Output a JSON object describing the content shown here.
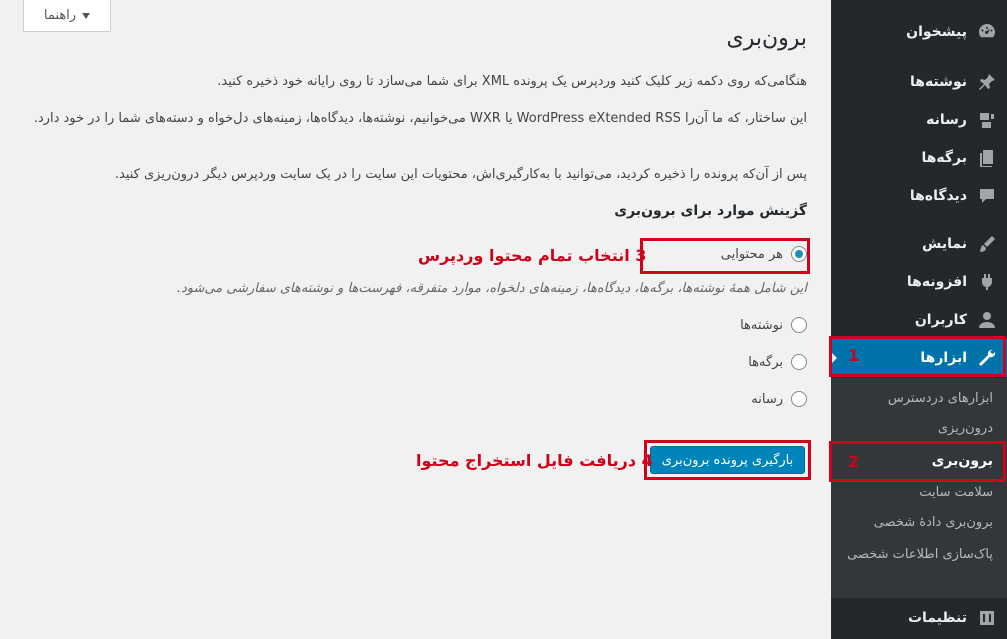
{
  "header": {
    "help_label": "راهنما",
    "page_title": "برون‌بری"
  },
  "intro": [
    "هنگامی‌که روی دکمه زیر کلیک کنید وردپرس یک پرونده XML برای شما می‌سازد تا روی رایانه خود ذخیره کنید.",
    "این ساختار، که ما آن‌را WordPress eXtended RSS یا WXR می‌خوانیم، نوشته‌ها، دیدگاه‌ها، زمینه‌های دل‌خواه و دسته‌های شما را در خود دارد.",
    "پس از آن‌که پرونده را ذخیره کردید، می‌توانید با به‌کارگیری‌اش، محتویات این سایت را در یک سایت وردپرس دیگر درون‌ریزی کنید."
  ],
  "export": {
    "section_title": "گزینش موارد برای برون‌بری",
    "options": [
      {
        "label": "هر محتوایی",
        "checked": true
      },
      {
        "label": "نوشته‌ها",
        "checked": false
      },
      {
        "label": "برگه‌ها",
        "checked": false
      },
      {
        "label": "رسانه",
        "checked": false
      }
    ],
    "all_content_description": "این شامل همهٔ نوشته‌ها، برگه‌ها، دیدگاه‌ها، زمینه‌های دلخواه، موارد متفرقه، فهرست‌ها و نوشته‌های سفارشی می‌شود.",
    "download_button": "بارگیری پرونده برون‌بری"
  },
  "sidebar": {
    "items": [
      {
        "label": "پیشخوان",
        "icon": "dashboard-icon"
      },
      {
        "label": "نوشته‌ها",
        "icon": "pin-icon"
      },
      {
        "label": "رسانه",
        "icon": "media-icon"
      },
      {
        "label": "برگه‌ها",
        "icon": "pages-icon"
      },
      {
        "label": "دیدگاه‌ها",
        "icon": "comment-icon"
      },
      {
        "label": "نمایش",
        "icon": "brush-icon"
      },
      {
        "label": "افزونه‌ها",
        "icon": "plugin-icon"
      },
      {
        "label": "کاربران",
        "icon": "user-icon"
      },
      {
        "label": "ابزارها",
        "icon": "wrench-icon",
        "current": true
      },
      {
        "label": "تنظیمات",
        "icon": "settings-icon"
      }
    ],
    "submenu": [
      {
        "label": "ابزارهای دردسترس"
      },
      {
        "label": "درون‌ریزی"
      },
      {
        "label": "برون‌بری",
        "active": true
      },
      {
        "label": "سلامت سایت"
      },
      {
        "label": "برون‌بری دادهٔ شخصی"
      },
      {
        "label": "پاک‌سازی اطلاعات شخصی"
      }
    ]
  },
  "annotations": {
    "num1": "1",
    "num2": "2",
    "note3": "3 انتخاب تمام محتوا وردپرس",
    "note4": "4 دریافت فایل استخراج محتوا"
  },
  "colors": {
    "sidebar_bg": "#23282d",
    "submenu_bg": "#32373c",
    "accent": "#0073aa",
    "annotation_red": "#d0021b"
  }
}
